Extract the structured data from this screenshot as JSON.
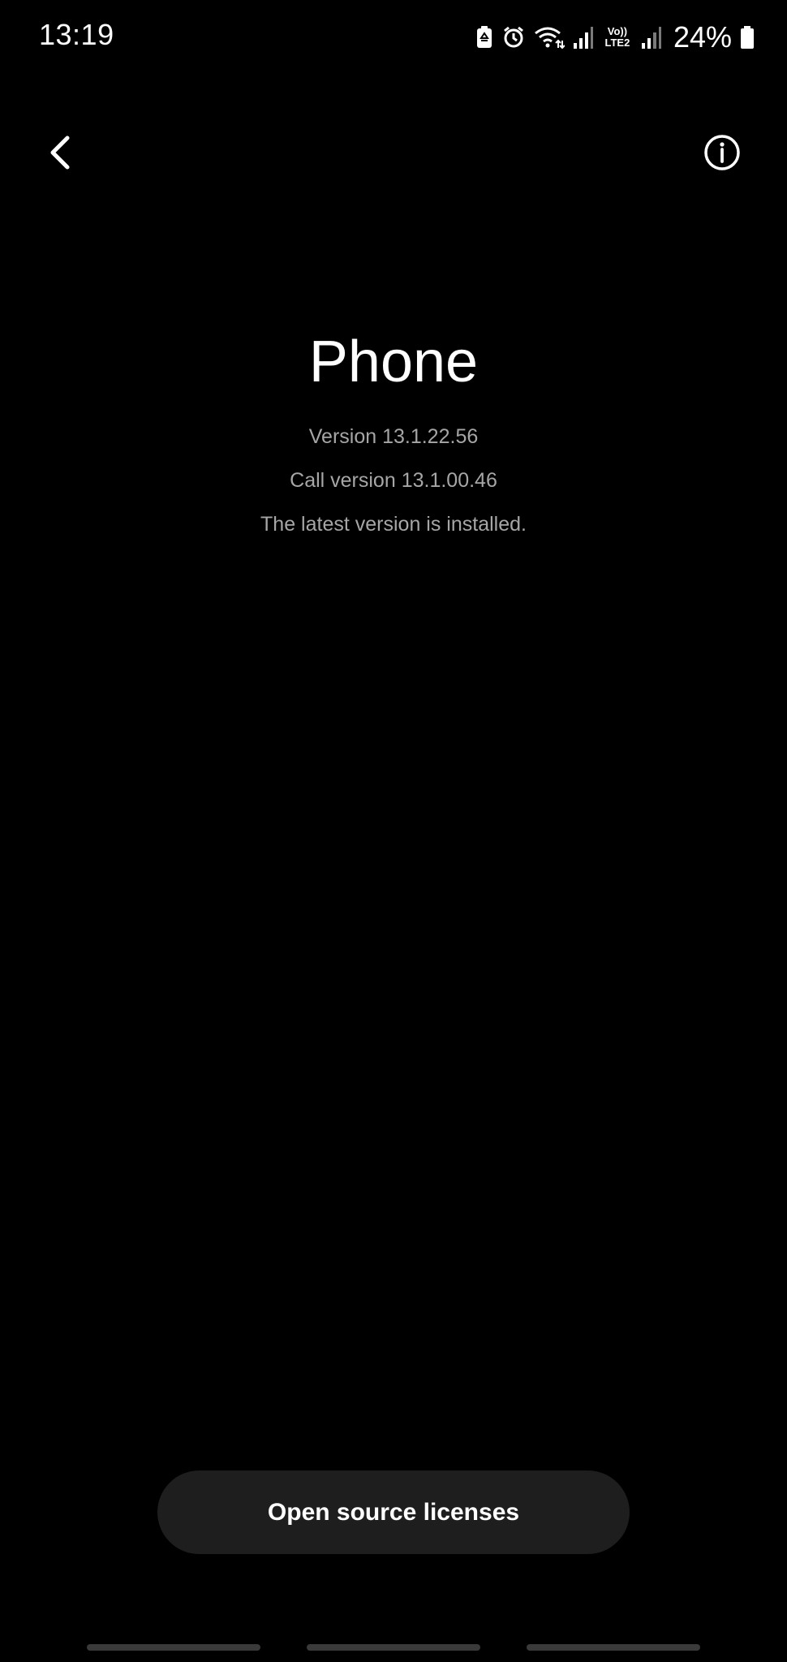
{
  "status_bar": {
    "time": "13:19",
    "network_label_top": "Vo))",
    "network_label_bottom": "LTE2",
    "battery_percent": "24%",
    "icons": [
      "battery-saver-icon",
      "alarm-icon",
      "wifi-icon",
      "signal-icon",
      "volte-icon",
      "signal-icon",
      "battery-icon"
    ]
  },
  "toolbar": {
    "back_icon": "back-chevron-icon",
    "info_icon": "info-icon"
  },
  "app": {
    "title": "Phone",
    "version": "Version 13.1.22.56",
    "call_version": "Call version 13.1.00.46",
    "status": "The latest version is installed."
  },
  "actions": {
    "licenses_label": "Open source licenses"
  },
  "colors": {
    "background": "#000000",
    "primary_text": "#ffffff",
    "secondary_text": "#a6a6a6",
    "button_background": "#1e1e1e"
  }
}
